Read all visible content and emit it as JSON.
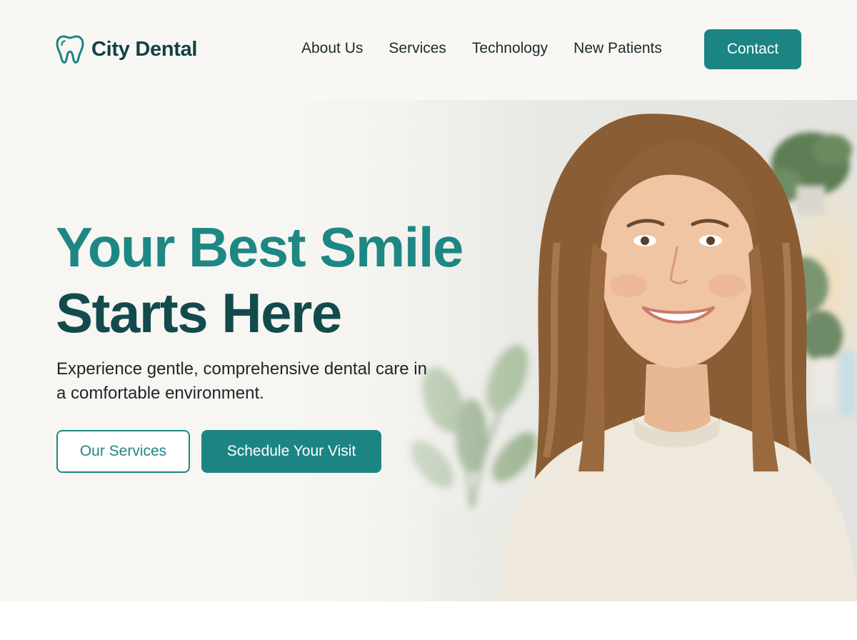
{
  "brand": {
    "name": "City Dental",
    "logo_icon": "tooth-icon",
    "primary_color": "#1c8584",
    "dark_color": "#134b4c"
  },
  "nav": {
    "items": [
      {
        "label": "About Us"
      },
      {
        "label": "Services"
      },
      {
        "label": "Technology"
      },
      {
        "label": "New Patients"
      }
    ],
    "contact_label": "Contact"
  },
  "hero": {
    "headline_line1": "Your Best Smile",
    "headline_line2": "Starts Here",
    "subtext": "Experience gentle, comprehensive dental care in a comfortable environment.",
    "secondary_cta": "Our Services",
    "primary_cta": "Schedule Your Visit",
    "image_subject": "smiling woman in cream sweater"
  }
}
